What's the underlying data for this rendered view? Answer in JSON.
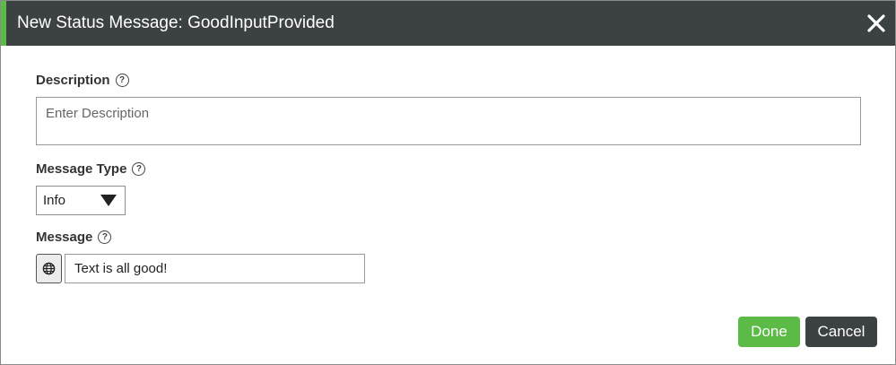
{
  "dialog": {
    "title": "New Status Message: GoodInputProvided",
    "close_icon": "close-icon",
    "accent_color": "#5cba47",
    "header_color": "#3c4143"
  },
  "description": {
    "label": "Description",
    "help_icon": "question-circle-icon",
    "placeholder": "Enter Description",
    "value": ""
  },
  "message_type": {
    "label": "Message Type",
    "help_icon": "question-circle-icon",
    "selected": "Info"
  },
  "message": {
    "label": "Message",
    "help_icon": "question-circle-icon",
    "language_icon": "globe-icon",
    "value": "Text is all good!"
  },
  "footer": {
    "done_label": "Done",
    "cancel_label": "Cancel"
  }
}
